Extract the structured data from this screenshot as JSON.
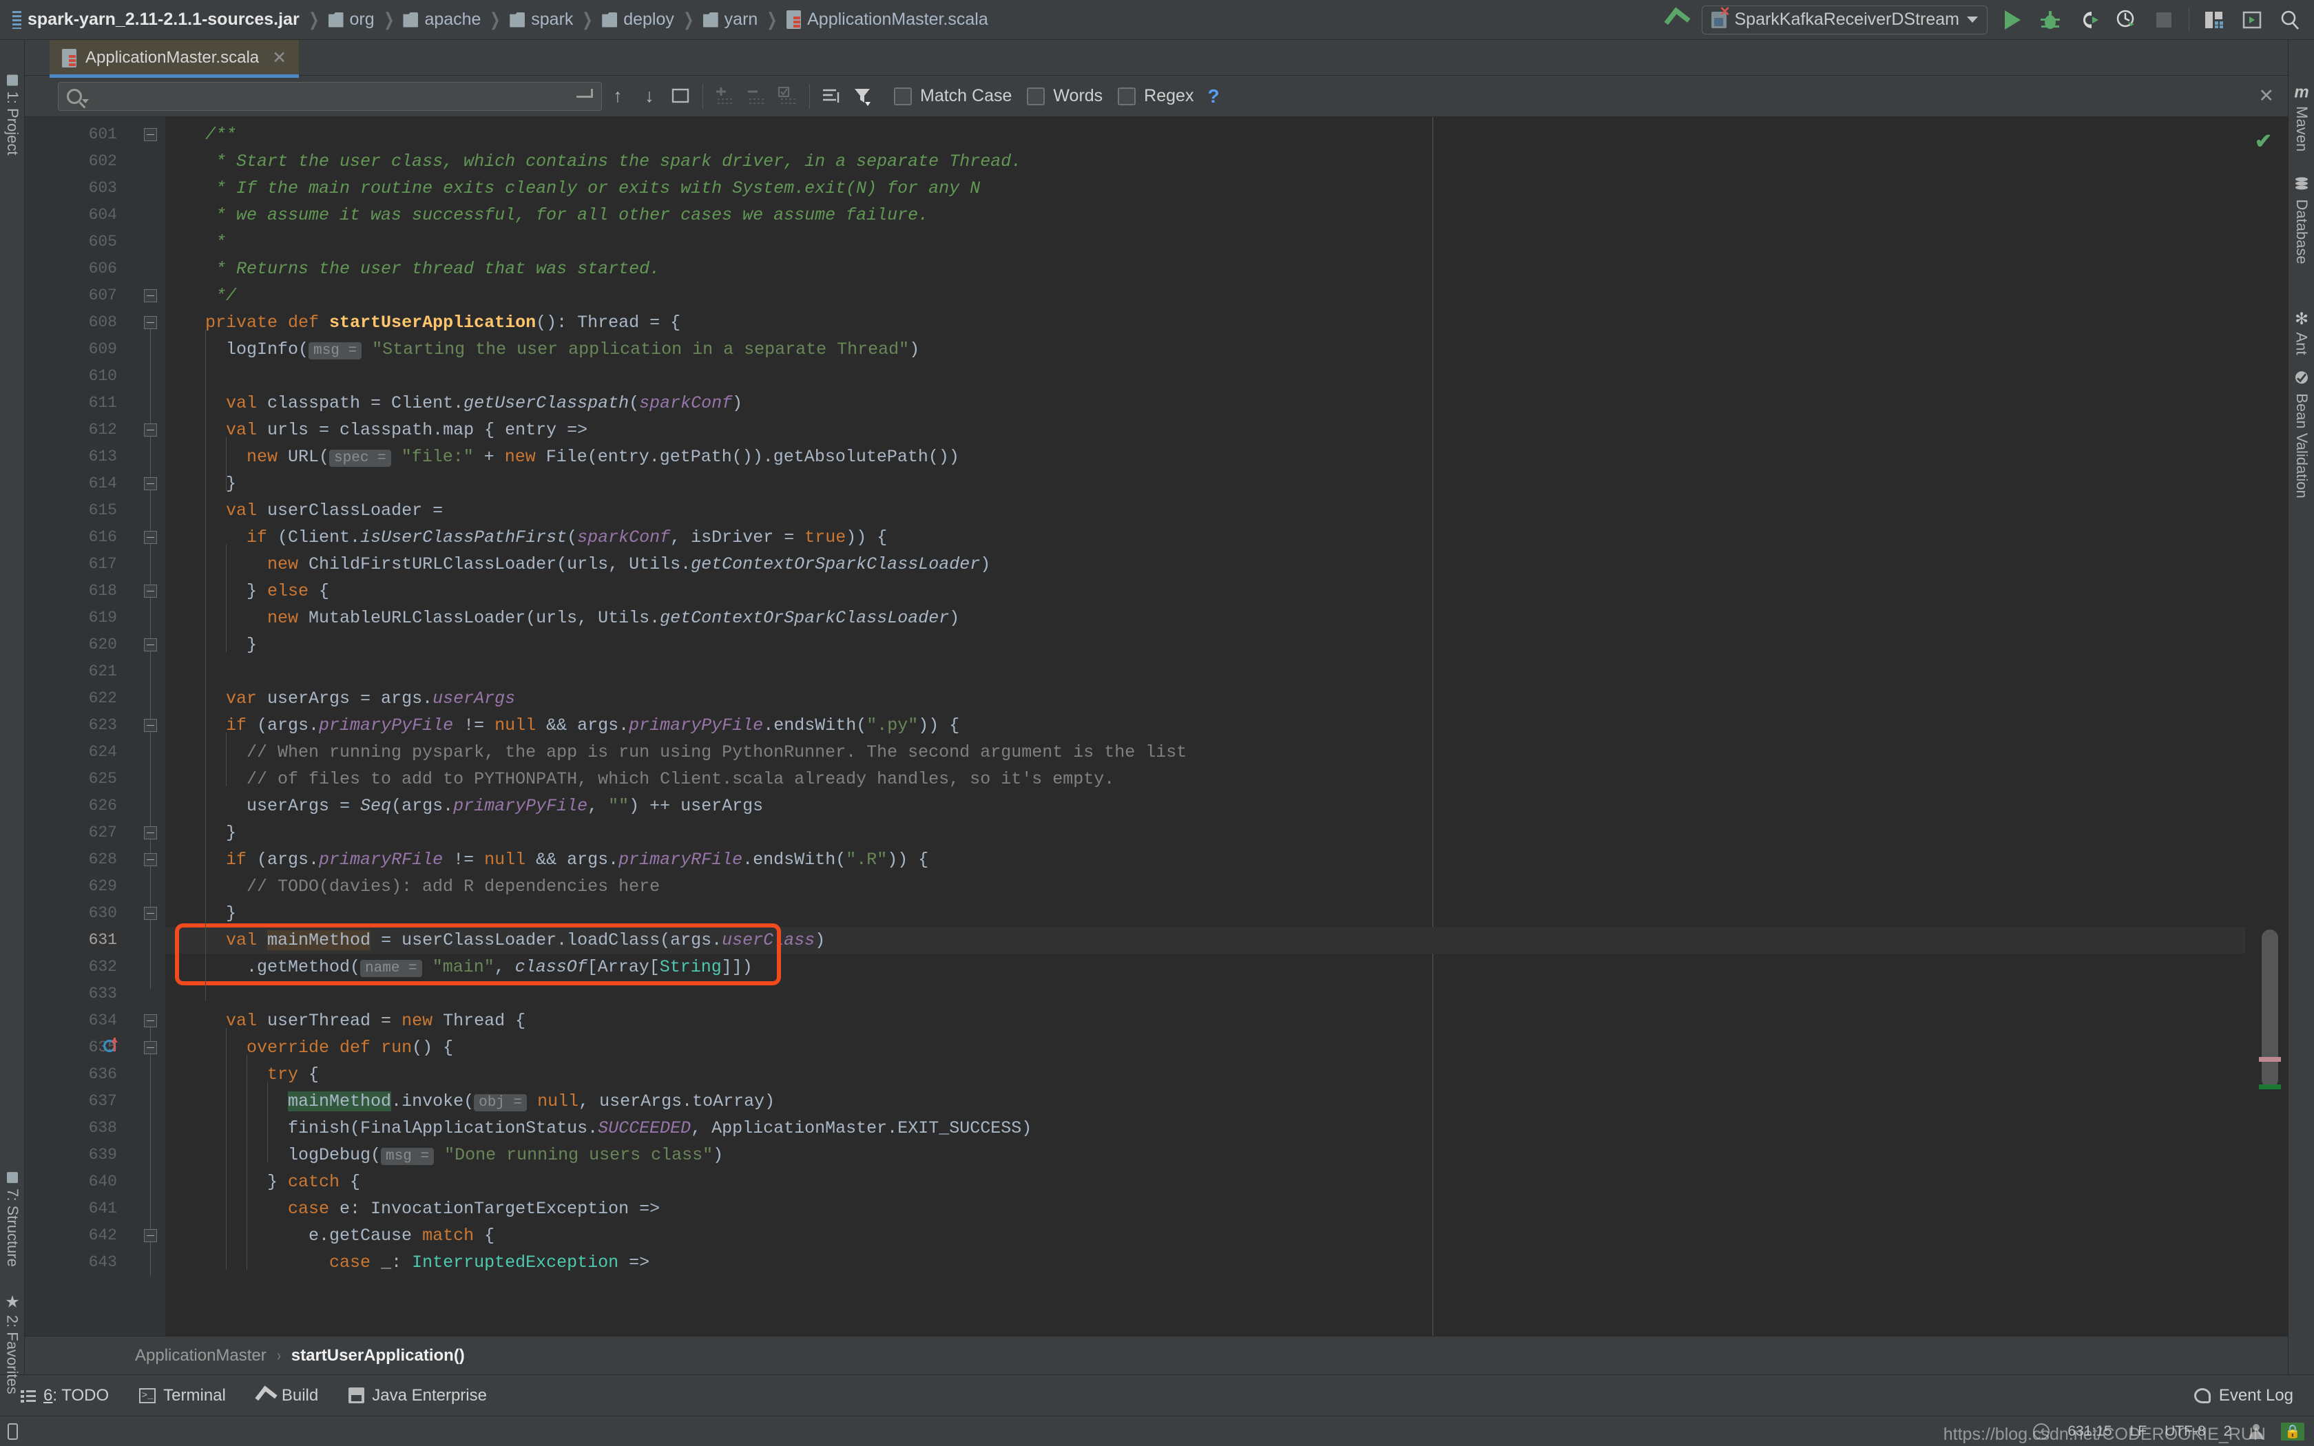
{
  "window": {
    "breadcrumb": [
      {
        "label": "spark-yarn_2.11-2.1.1-sources.jar",
        "icon": "jar-icon",
        "kind": "jar"
      },
      {
        "label": "org",
        "icon": "folder-icon",
        "kind": "folder"
      },
      {
        "label": "apache",
        "icon": "folder-icon",
        "kind": "folder"
      },
      {
        "label": "spark",
        "icon": "folder-icon",
        "kind": "folder"
      },
      {
        "label": "deploy",
        "icon": "folder-icon",
        "kind": "folder"
      },
      {
        "label": "yarn",
        "icon": "folder-icon",
        "kind": "folder"
      },
      {
        "label": "ApplicationMaster.scala",
        "icon": "scala-file-icon",
        "kind": "file"
      }
    ],
    "run_configuration": "SparkKafkaReceiverDStream",
    "toolbar_icons": [
      "build-icon",
      "run-icon",
      "debug-icon",
      "run-with-coverage-icon",
      "profile-icon",
      "stop-icon",
      "project-structure-icon",
      "select-target-icon",
      "search-everywhere-icon"
    ]
  },
  "left_rail": {
    "items": [
      {
        "label": "1: Project",
        "icon": "project-icon"
      },
      {
        "label": "7: Structure",
        "icon": "structure-icon"
      },
      {
        "label": "2: Favorites",
        "icon": "star-icon"
      }
    ]
  },
  "right_rail": {
    "items": [
      {
        "label": "Maven",
        "icon": "maven-icon"
      },
      {
        "label": "Database",
        "icon": "database-icon"
      },
      {
        "label": "Ant",
        "icon": "ant-icon"
      },
      {
        "label": "Bean Validation",
        "icon": "bean-validation-icon"
      }
    ]
  },
  "tabs": [
    {
      "label": "ApplicationMaster.scala",
      "icon": "scala-file-icon",
      "active": true,
      "close": "✕"
    }
  ],
  "find_bar": {
    "search_value": "",
    "search_placeholder": "",
    "buttons": [
      {
        "name": "find-previous",
        "icon": "arrow-up-icon"
      },
      {
        "name": "find-next",
        "icon": "arrow-down-icon"
      },
      {
        "name": "select-all-occurrences",
        "icon": "select-all-icon"
      },
      {
        "name": "add-selection",
        "icon": "plus-icon"
      },
      {
        "name": "remove-selection",
        "icon": "minus-icon"
      },
      {
        "name": "select-all-check",
        "icon": "checkbox-icon"
      },
      {
        "name": "filter-lines",
        "icon": "filter-lines-icon"
      },
      {
        "name": "filter",
        "icon": "funnel-icon"
      }
    ],
    "options": [
      {
        "label": "Match Case",
        "checked": false
      },
      {
        "label": "Words",
        "checked": false
      },
      {
        "label": "Regex",
        "checked": false
      }
    ],
    "help": "?",
    "close": "✕"
  },
  "editor": {
    "first_line": 601,
    "current_line": 631,
    "highlight_box_lines": [
      631,
      632
    ],
    "intention_bulb_line": 631,
    "override_marker_line": 635,
    "lines": [
      {
        "n": 601,
        "html": "  <span class='cmt'>/**</span>"
      },
      {
        "n": 602,
        "html": "   <span class='cmt'>* Start the user class, which contains the spark driver, in a separate Thread.</span>"
      },
      {
        "n": 603,
        "html": "   <span class='cmt'>* If the main routine exits cleanly or exits with System.exit(N) for any N</span>"
      },
      {
        "n": 604,
        "html": "   <span class='cmt'>* we assume it was successful, for all other cases we assume failure.</span>"
      },
      {
        "n": 605,
        "html": "   <span class='cmt'>*</span>"
      },
      {
        "n": 606,
        "html": "   <span class='cmt'>* Returns the user thread that was started.</span>"
      },
      {
        "n": 607,
        "html": "   <span class='cmt'>*/</span>"
      },
      {
        "n": 608,
        "html": "  <span class='kw'>private def </span><span class='fnb'>startUserApplication</span>(): Thread = {"
      },
      {
        "n": 609,
        "html": "    logInfo(<span class='hint'>msg =</span> <span class='str'>\"Starting the user application in a separate Thread\"</span>)"
      },
      {
        "n": 610,
        "html": ""
      },
      {
        "n": 611,
        "html": "    <span class='kw'>val </span>classpath = Client.<span class='sm'>getUserClasspath</span>(<span class='fld'>sparkConf</span>)"
      },
      {
        "n": 612,
        "html": "    <span class='kw'>val </span>urls = classpath.map { entry =&gt;"
      },
      {
        "n": 613,
        "html": "      <span class='kw'>new </span>URL(<span class='hint'>spec =</span> <span class='str'>\"file:\"</span> + <span class='kw'>new </span>File(entry.getPath()).getAbsolutePath())"
      },
      {
        "n": 614,
        "html": "    }"
      },
      {
        "n": 615,
        "html": "    <span class='kw'>val </span>userClassLoader ="
      },
      {
        "n": 616,
        "html": "      <span class='kw'>if </span>(Client.<span class='sm'>isUserClassPathFirst</span>(<span class='fld'>sparkConf</span>, isDriver = <span class='kw'>true</span>)) {"
      },
      {
        "n": 617,
        "html": "        <span class='kw'>new </span>ChildFirstURLClassLoader(urls, Utils.<span class='sm'>getContextOrSparkClassLoader</span>)"
      },
      {
        "n": 618,
        "html": "      } <span class='kw'>else </span>{"
      },
      {
        "n": 619,
        "html": "        <span class='kw'>new </span>MutableURLClassLoader(urls, Utils.<span class='sm'>getContextOrSparkClassLoader</span>)"
      },
      {
        "n": 620,
        "html": "      }"
      },
      {
        "n": 621,
        "html": ""
      },
      {
        "n": 622,
        "html": "    <span class='kw'>var </span>userArgs = args.<span class='fld'>userArgs</span>"
      },
      {
        "n": 623,
        "html": "    <span class='kw'>if </span>(args.<span class='fld'>primaryPyFile</span> != <span class='kw'>null </span>&amp;&amp; args.<span class='fld'>primaryPyFile</span>.endsWith(<span class='str'>\".py\"</span>)) {"
      },
      {
        "n": 624,
        "html": "      <span class='lcmt'>// When running pyspark, the app is run using PythonRunner. The second argument is the list</span>"
      },
      {
        "n": 625,
        "html": "      <span class='lcmt'>// of files to add to PYTHONPATH, which Client.scala already handles, so it's empty.</span>"
      },
      {
        "n": 626,
        "html": "      userArgs = <span class='sm'>Seq</span>(args.<span class='fld'>primaryPyFile</span>, <span class='str'>\"\"</span>) ++ userArgs"
      },
      {
        "n": 627,
        "html": "    }"
      },
      {
        "n": 628,
        "html": "    <span class='kw'>if </span>(args.<span class='fld'>primaryRFile</span> != <span class='kw'>null </span>&amp;&amp; args.<span class='fld'>primaryRFile</span>.endsWith(<span class='str'>\".R\"</span>)) {"
      },
      {
        "n": 629,
        "html": "      <span class='lcmt'>// TODO(davies): add R dependencies here</span>"
      },
      {
        "n": 630,
        "html": "    }"
      },
      {
        "n": 631,
        "html": "    <span class='kw'>val </span><span class='wocc'>mainMethod</span> = userClassLoader.loadClass(args.<span class='fld'>userClass</span>)"
      },
      {
        "n": 632,
        "html": "      .getMethod(<span class='hint'>name =</span> <span class='str'>\"main\"</span>, <span class='sm'>classOf</span>[Array[<span class='typ'>String</span>]])"
      },
      {
        "n": 633,
        "html": ""
      },
      {
        "n": 634,
        "html": "    <span class='kw'>val </span>userThread = <span class='kw'>new </span>Thread {"
      },
      {
        "n": 635,
        "html": "      <span class='kw'>override def </span><span class='kw'>run</span>() {"
      },
      {
        "n": 636,
        "html": "        <span class='kw'>try </span>{"
      },
      {
        "n": 637,
        "html": "          <span class='occ'>mainMethod</span>.invoke(<span class='hint'>obj =</span> <span class='kw'>null</span>, userArgs.toArray)"
      },
      {
        "n": 638,
        "html": "          finish(FinalApplicationStatus.<span class='fld'>SUCCEEDED</span>, ApplicationMaster.EXIT_SUCCESS)"
      },
      {
        "n": 639,
        "html": "          logDebug(<span class='hint'>msg =</span> <span class='str'>\"Done running users class\"</span>)"
      },
      {
        "n": 640,
        "html": "        } <span class='kw'>catch </span>{"
      },
      {
        "n": 641,
        "html": "          <span class='kw'>case </span>e: InvocationTargetException =&gt;"
      },
      {
        "n": 642,
        "html": "            e.getCause <span class='kw'>match </span>{"
      },
      {
        "n": 643,
        "html": "              <span class='kw'>case </span>_: <span class='typ'>InterruptedException</span> =&gt;"
      }
    ],
    "plain_lines": [
      "  /**",
      "   * Start the user class, which contains the spark driver, in a separate Thread.",
      "   * If the main routine exits cleanly or exits with System.exit(N) for any N",
      "   * we assume it was successful, for all other cases we assume failure.",
      "   *",
      "   * Returns the user thread that was started.",
      "   */",
      "  private def startUserApplication(): Thread = {",
      "    logInfo( msg = \"Starting the user application in a separate Thread\")",
      "",
      "    val classpath = Client.getUserClasspath(sparkConf)",
      "    val urls = classpath.map { entry =>",
      "      new URL( spec = \"file:\" + new File(entry.getPath()).getAbsolutePath())",
      "    }",
      "    val userClassLoader =",
      "      if (Client.isUserClassPathFirst(sparkConf, isDriver = true)) {",
      "        new ChildFirstURLClassLoader(urls, Utils.getContextOrSparkClassLoader)",
      "      } else {",
      "        new MutableURLClassLoader(urls, Utils.getContextOrSparkClassLoader)",
      "      }",
      "",
      "    var userArgs = args.userArgs",
      "    if (args.primaryPyFile != null && args.primaryPyFile.endsWith(\".py\")) {",
      "      // When running pyspark, the app is run using PythonRunner. The second argument is the list",
      "      // of files to add to PYTHONPATH, which Client.scala already handles, so it's empty.",
      "      userArgs = Seq(args.primaryPyFile, \"\") ++ userArgs",
      "    }",
      "    if (args.primaryRFile != null && args.primaryRFile.endsWith(\".R\")) {",
      "      // TODO(davies): add R dependencies here",
      "    }",
      "    val mainMethod = userClassLoader.loadClass(args.userClass)",
      "      .getMethod( name = \"main\", classOf[Array[String]])",
      "",
      "    val userThread = new Thread {",
      "      override def run() {",
      "        try {",
      "          mainMethod.invoke( obj = null, userArgs.toArray)",
      "          finish(FinalApplicationStatus.SUCCEEDED, ApplicationMaster.EXIT_SUCCESS)",
      "          logDebug( msg = \"Done running users class\")",
      "        } catch {",
      "          case e: InvocationTargetException =>",
      "            e.getCause match {",
      "              case _: InterruptedException =>"
    ]
  },
  "navigation_bar": {
    "class": "ApplicationMaster",
    "separator": "›",
    "member": "startUserApplication()"
  },
  "bottom_toolwindows": [
    {
      "label": "6: TODO",
      "mnemonic": "6",
      "icon": "todo-icon"
    },
    {
      "label": "Terminal",
      "icon": "terminal-icon"
    },
    {
      "label": "Build",
      "icon": "build-icon"
    },
    {
      "label": "Java Enterprise",
      "icon": "java-enterprise-icon"
    }
  ],
  "event_log": {
    "label": "Event Log",
    "icon": "event-log-icon"
  },
  "status_bar": {
    "caret_position": "631:15",
    "line_separator": "LF",
    "encoding": "UTF-8",
    "indent": "2",
    "watermark": "https://blog.csdn.net/CODEROOKIE_RUN",
    "lock_icon": "read-only-lock-icon"
  },
  "colors": {
    "editor_bg": "#2b2b2b",
    "chrome_bg": "#3c3f41",
    "gutter_bg": "#313335",
    "keyword": "#cc7832",
    "string": "#6a8759",
    "comment_block": "#629755",
    "comment_line": "#808080",
    "field": "#9876aa",
    "method_decl": "#ffc66d",
    "identifier": "#a9b7c6",
    "type": "#4ec9b0",
    "accent_box": "#f04a1e",
    "tab_active": "#4e4a3e",
    "tab_underline": "#4a88c7",
    "run_green": "#59a869"
  }
}
